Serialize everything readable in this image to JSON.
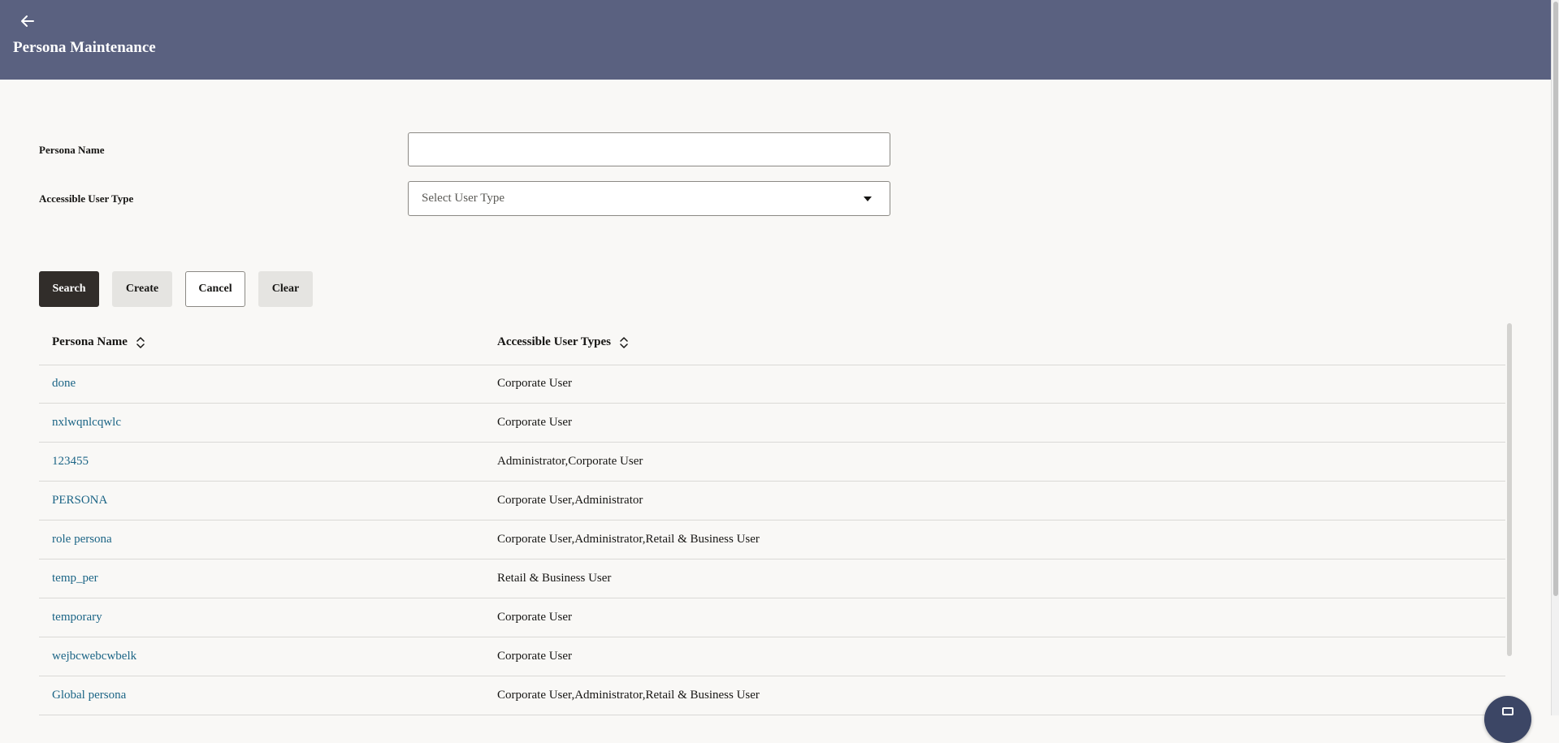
{
  "header": {
    "title": "Persona Maintenance",
    "back_icon": "arrow-left-icon",
    "background": "#5a6180"
  },
  "form": {
    "persona_name_label": "Persona Name",
    "persona_name_value": "",
    "user_type_label": "Accessible User Type",
    "user_type_placeholder": "Select User Type"
  },
  "buttons": {
    "search": "Search",
    "create": "Create",
    "cancel": "Cancel",
    "clear": "Clear"
  },
  "table": {
    "columns": [
      "Persona Name",
      "Accessible User Types"
    ],
    "rows": [
      {
        "name": "done",
        "types": "Corporate User"
      },
      {
        "name": "nxlwqnlcqwlc",
        "types": "Corporate User"
      },
      {
        "name": "123455",
        "types": "Administrator,Corporate User"
      },
      {
        "name": "PERSONA",
        "types": "Corporate User,Administrator"
      },
      {
        "name": "role persona",
        "types": "Corporate User,Administrator,Retail & Business User"
      },
      {
        "name": "temp_per",
        "types": "Retail & Business User"
      },
      {
        "name": "temporary",
        "types": "Corporate User"
      },
      {
        "name": "wejbcwebcwbelk",
        "types": "Corporate User"
      },
      {
        "name": "Global persona",
        "types": "Corporate User,Administrator,Retail & Business User"
      }
    ]
  },
  "colors": {
    "link": "#1c6586",
    "primary_button": "#312d2a",
    "secondary_button": "#e5e4e1"
  }
}
